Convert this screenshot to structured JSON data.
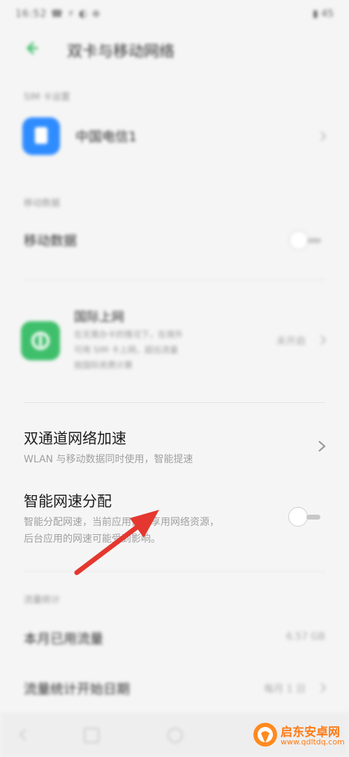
{
  "status_bar": {
    "time": "16:52 ☎ ⚡ ◐ ⊕",
    "battery": "▮ 45"
  },
  "header": {
    "title": "双卡与移动网络"
  },
  "sim_section": {
    "caption": "SIM 卡设置",
    "sim1_label": "中国电信1"
  },
  "data_section": {
    "caption": "移动数据",
    "mobile_data_label": "移动数据",
    "mobile_data_toggle": "off"
  },
  "roaming": {
    "title": "国际上网",
    "desc_line1": "在无需办卡的情况下，在境外",
    "desc_line2": "可用 SIM 卡上网，超出流量",
    "desc_line3": "按国际资费计算",
    "status": "未开启"
  },
  "dual_channel": {
    "title": "双通道网络加速",
    "subtitle": "WLAN 与移动数据同时使用，智能提速"
  },
  "smart_speed": {
    "title": "智能网速分配",
    "subtitle_line1": "智能分配网速，当前应用优先享用网络资源，",
    "subtitle_line2": "后台应用的网速可能受到影响。",
    "toggle": "off"
  },
  "traffic_section": {
    "caption": "流量统计",
    "monthly_label": "本月已用流量",
    "monthly_value": "6.57 GB",
    "start_date_label": "流量统计开始日期",
    "start_date_value": "每月 1 日"
  },
  "watermark": {
    "site_name": "启东安卓网",
    "site_url": "www.qdltdq.com"
  },
  "colors": {
    "accent_green": "#3fbf6b",
    "sim_blue": "#2f8cff",
    "arrow_red": "#e4372f"
  }
}
